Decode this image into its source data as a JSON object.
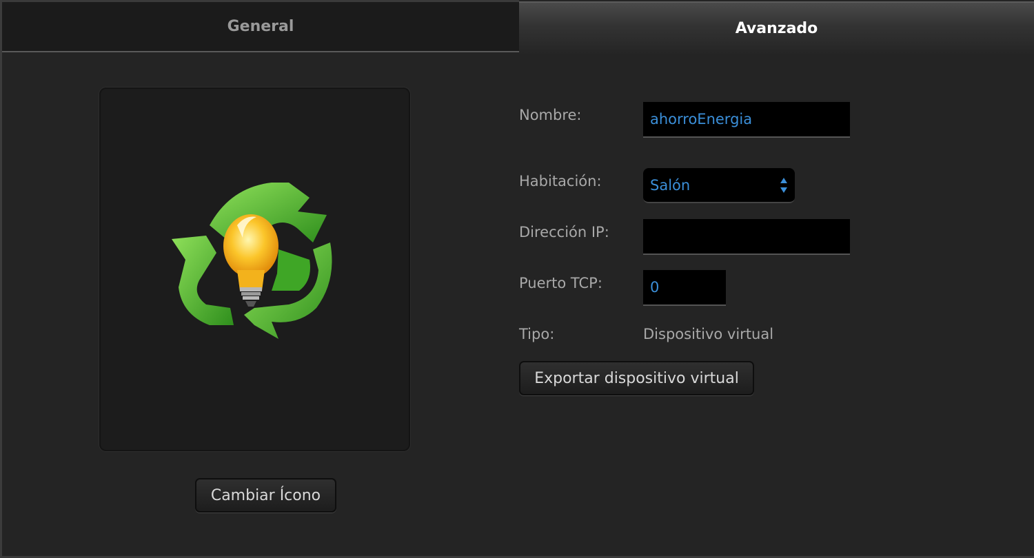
{
  "tabs": {
    "general": "General",
    "advanced": "Avanzado"
  },
  "icon_panel": {
    "icon": "recycle-lightbulb-icon",
    "change_button": "Cambiar Ícono"
  },
  "form": {
    "name": {
      "label": "Nombre:",
      "value": "ahorroEnergia"
    },
    "room": {
      "label": "Habitación:",
      "value": "Salón"
    },
    "ip": {
      "label": "Dirección IP:",
      "value": ""
    },
    "port": {
      "label": "Puerto TCP:",
      "value": "0"
    },
    "type": {
      "label": "Tipo:",
      "value": "Dispositivo virtual"
    },
    "export_button": "Exportar dispositivo virtual"
  },
  "colors": {
    "background": "#242424",
    "accent_text": "#3b8fd9",
    "recycle_green": "#4caf2a",
    "bulb_yellow": "#f7b417"
  }
}
